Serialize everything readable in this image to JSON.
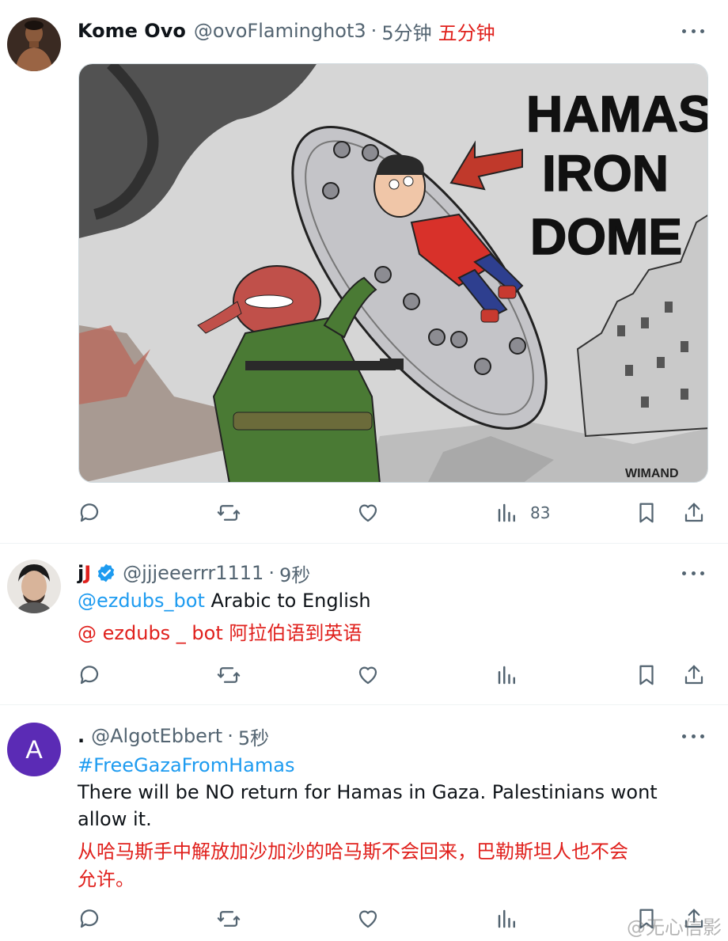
{
  "colors": {
    "accent": "#1d9bf0",
    "muted": "#536471",
    "translation_red": "#e0201c",
    "verified": "#1d9bf0"
  },
  "tweets": [
    {
      "name": "Kome Ovo",
      "handle": "@ovoFlaminghot3",
      "sep": "·",
      "time": "5分钟",
      "time_translation": "五分钟",
      "media": {
        "title_lines": [
          "HAMAS'",
          "IRON",
          "DOME"
        ],
        "signature": "WIMAND"
      },
      "actions": {
        "views": "83"
      }
    },
    {
      "name_part1": "j",
      "name_part2": "J",
      "handle": "@jjjeeerrr1111",
      "sep": "·",
      "time": "9秒",
      "mention": "@ezdubs_bot",
      "text": " Arabic to English",
      "translation": "@ ezdubs _ bot 阿拉伯语到英语"
    },
    {
      "avatar_letter": "A",
      "name": ".",
      "handle": "@AlgotEbbert",
      "sep": "·",
      "time": "5秒",
      "hashtag": "#FreeGazaFromHamas",
      "text_line1": "There will be NO return for Hamas in Gaza. Palestinians wont",
      "text_line2": "allow it.",
      "translation_line1": "从哈马斯手中解放加沙加沙的哈马斯不会回来，巴勒斯坦人也不会",
      "translation_line2": "允许。"
    }
  ],
  "watermark": "@无心信影"
}
